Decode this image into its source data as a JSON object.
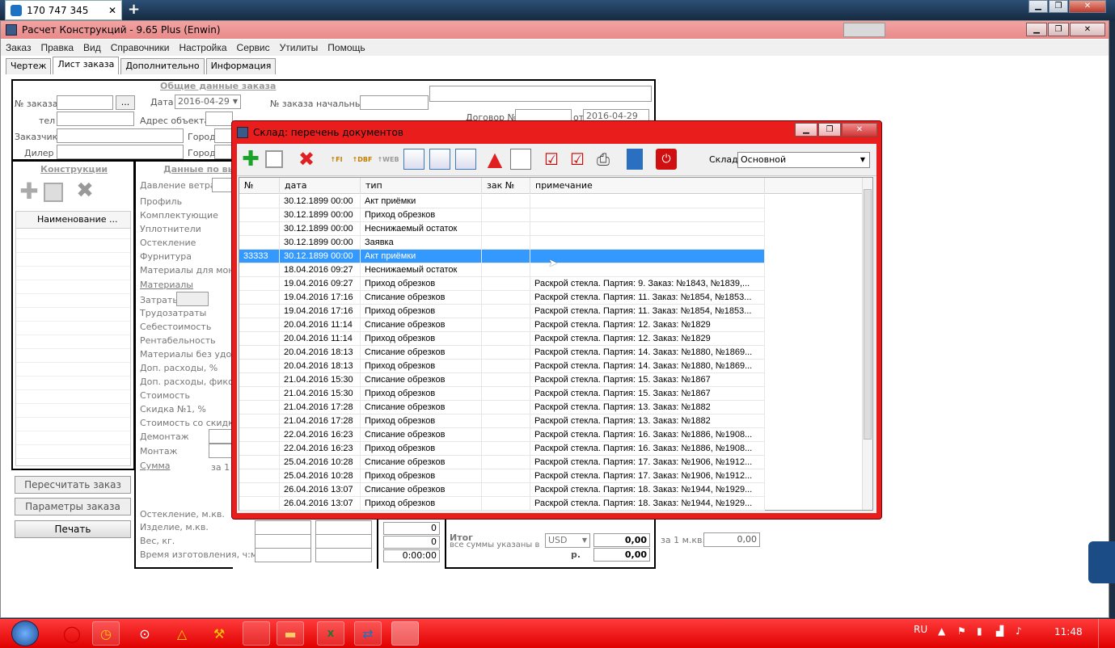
{
  "remote": {
    "session_id": "170 747 345",
    "close_glyph": "✕",
    "add_glyph": "+"
  },
  "app": {
    "title": "Расчет Конструкций - 9.65 Plus (Enwin)",
    "menu": [
      "Заказ",
      "Правка",
      "Вид",
      "Справочники",
      "Настройка",
      "Сервис",
      "Утилиты",
      "Помощь"
    ],
    "tabs": [
      "Чертеж",
      "Лист заказа",
      "Дополнительно",
      "Информация"
    ],
    "active_tab": "Лист заказа"
  },
  "order": {
    "section_title": "Общие данные заказа",
    "order_no_label": "№ заказа",
    "browse_label": "...",
    "date_label": "Дата",
    "date_value": "2016-04-29",
    "initial_order_label": "№ заказа начальный",
    "phone_label": "тел",
    "address_label": "Адрес объекта",
    "contract_label": "Договор №",
    "from_label": "от",
    "contract_date": "2016-04-29",
    "customer_label": "Заказчик",
    "city_label": "Город",
    "dealer_label": "Дилер",
    "city2_label": "Город"
  },
  "constructions": {
    "title": "Конструкции",
    "col_name": "Наименование ..."
  },
  "calc": {
    "title": "Данные по вы",
    "labels": [
      "Давление ветра",
      "Профиль",
      "Комплектующие",
      "Уплотнители",
      "Остекление",
      "Фурнитура",
      "Материалы для монта",
      "Материалы",
      "Затраты",
      "Трудозатраты",
      "Себестоимость",
      "Рентабельность",
      "Материалы без удоро",
      "Доп. расходы, %",
      "Доп. расходы, фикс",
      "Стоимость",
      "Скидка №1, %",
      "Стоимость со скидкой",
      "Демонтаж",
      "Монтаж",
      "Сумма"
    ],
    "per1": "за 1"
  },
  "buttons": {
    "recalc": "Пересчитать заказ",
    "params": "Параметры заказа",
    "print": "Печать"
  },
  "bottom": {
    "glazing": "Остекление, м.кв.",
    "product": "Изделие, м.кв.",
    "weight": "Вес, кг.",
    "time": "Время изготовления, ч:м:с",
    "v1": "0",
    "v2": "0",
    "v3": "0:00:00",
    "total_label": "Итог",
    "sums_note": "все суммы указаны в",
    "currency": "USD",
    "total_value": "0,00",
    "rub_label": "р.",
    "rub_value": "0,00",
    "per_m2_label": "за 1 м.кв.",
    "per_m2_value": "0,00"
  },
  "dialog": {
    "title": "Склад: перечень документов",
    "warehouse_label": "Склад",
    "warehouse_value": "Основной",
    "columns": {
      "no": "№",
      "date": "дата",
      "type": "тип",
      "order_no": "зак №",
      "note": "примечание"
    },
    "rows": [
      {
        "no": "",
        "date": "30.12.1899 00:00",
        "type": "Акт приёмки",
        "order_no": "",
        "note": ""
      },
      {
        "no": "",
        "date": "30.12.1899 00:00",
        "type": "Приход обрезков",
        "order_no": "",
        "note": ""
      },
      {
        "no": "",
        "date": "30.12.1899 00:00",
        "type": "Неснижаемый остаток",
        "order_no": "",
        "note": ""
      },
      {
        "no": "",
        "date": "30.12.1899 00:00",
        "type": "Заявка",
        "order_no": "",
        "note": ""
      },
      {
        "no": "33333",
        "date": "30.12.1899 00:00",
        "type": "Акт приёмки",
        "order_no": "",
        "note": ""
      },
      {
        "no": "",
        "date": "18.04.2016 09:27",
        "type": "Неснижаемый остаток",
        "order_no": "",
        "note": ""
      },
      {
        "no": "",
        "date": "19.04.2016 09:27",
        "type": "Приход обрезков",
        "order_no": "",
        "note": "Раскрой стекла. Партия: 9. Заказ: №1843, №1839,..."
      },
      {
        "no": "",
        "date": "19.04.2016 17:16",
        "type": "Списание обрезков",
        "order_no": "",
        "note": "Раскрой стекла. Партия: 11. Заказ: №1854, №1853..."
      },
      {
        "no": "",
        "date": "19.04.2016 17:16",
        "type": "Приход обрезков",
        "order_no": "",
        "note": "Раскрой стекла. Партия: 11. Заказ: №1854, №1853..."
      },
      {
        "no": "",
        "date": "20.04.2016 11:14",
        "type": "Списание обрезков",
        "order_no": "",
        "note": "Раскрой стекла. Партия: 12. Заказ: №1829"
      },
      {
        "no": "",
        "date": "20.04.2016 11:14",
        "type": "Приход обрезков",
        "order_no": "",
        "note": "Раскрой стекла. Партия: 12. Заказ: №1829"
      },
      {
        "no": "",
        "date": "20.04.2016 18:13",
        "type": "Списание обрезков",
        "order_no": "",
        "note": "Раскрой стекла. Партия: 14. Заказ: №1880, №1869..."
      },
      {
        "no": "",
        "date": "20.04.2016 18:13",
        "type": "Приход обрезков",
        "order_no": "",
        "note": "Раскрой стекла. Партия: 14. Заказ: №1880, №1869..."
      },
      {
        "no": "",
        "date": "21.04.2016 15:30",
        "type": "Списание обрезков",
        "order_no": "",
        "note": "Раскрой стекла. Партия: 15. Заказ: №1867"
      },
      {
        "no": "",
        "date": "21.04.2016 15:30",
        "type": "Приход обрезков",
        "order_no": "",
        "note": "Раскрой стекла. Партия: 15. Заказ: №1867"
      },
      {
        "no": "",
        "date": "21.04.2016 17:28",
        "type": "Списание обрезков",
        "order_no": "",
        "note": "Раскрой стекла. Партия: 13. Заказ: №1882"
      },
      {
        "no": "",
        "date": "21.04.2016 17:28",
        "type": "Приход обрезков",
        "order_no": "",
        "note": "Раскрой стекла. Партия: 13. Заказ: №1882"
      },
      {
        "no": "",
        "date": "22.04.2016 16:23",
        "type": "Списание обрезков",
        "order_no": "",
        "note": "Раскрой стекла. Партия: 16. Заказ: №1886, №1908..."
      },
      {
        "no": "",
        "date": "22.04.2016 16:23",
        "type": "Приход обрезков",
        "order_no": "",
        "note": "Раскрой стекла. Партия: 16. Заказ: №1886, №1908..."
      },
      {
        "no": "",
        "date": "25.04.2016 10:28",
        "type": "Списание обрезков",
        "order_no": "",
        "note": "Раскрой стекла. Партия: 17. Заказ: №1906, №1912..."
      },
      {
        "no": "",
        "date": "25.04.2016 10:28",
        "type": "Приход обрезков",
        "order_no": "",
        "note": "Раскрой стекла. Партия: 17. Заказ: №1906, №1912..."
      },
      {
        "no": "",
        "date": "26.04.2016 13:07",
        "type": "Списание обрезков",
        "order_no": "",
        "note": "Раскрой стекла. Партия: 18. Заказ: №1944, №1929..."
      },
      {
        "no": "",
        "date": "26.04.2016 13:07",
        "type": "Приход обрезков",
        "order_no": "",
        "note": "Раскрой стекла. Партия: 18. Заказ: №1944, №1929..."
      }
    ],
    "selected_index": 4
  },
  "taskbar": {
    "lang": "RU",
    "time": "11:48"
  },
  "colors": {
    "dialog_frame": "#ea1d1d",
    "selection": "#3399ff",
    "taskbar": "#f01010",
    "titlebar": "#f19a9a"
  }
}
